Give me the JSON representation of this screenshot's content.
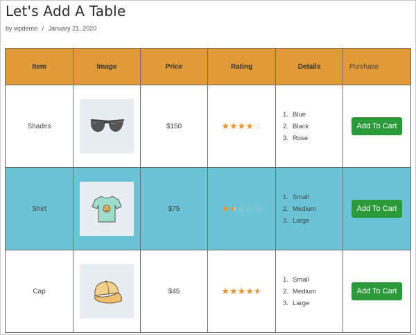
{
  "post": {
    "title": "Let's Add A Table",
    "by_prefix": "by",
    "author": "wpdemo",
    "separator": "/",
    "date": "January 21, 2020"
  },
  "table": {
    "headers": {
      "item": "Item",
      "image": "Image",
      "price": "Price",
      "rating": "Rating",
      "details": "Details",
      "purchase": "Purchase"
    },
    "rows": [
      {
        "item": "Shades",
        "image_icon": "sunglasses-icon",
        "price": "$150",
        "rating": 4,
        "details": [
          "Blue",
          "Black",
          "Rose"
        ],
        "button": "Add To Cart"
      },
      {
        "item": "Shirt",
        "image_icon": "tshirt-icon",
        "price": "$75",
        "rating": 1.5,
        "details": [
          "Small",
          "Medium",
          "Large"
        ],
        "button": "Add To Cart"
      },
      {
        "item": "Cap",
        "image_icon": "cap-icon",
        "price": "$45",
        "rating": 4.5,
        "details": [
          "Small",
          "Medium",
          "Large"
        ],
        "button": "Add To Cart"
      }
    ],
    "list_numbers": [
      "1.",
      "2.",
      "3."
    ]
  },
  "colors": {
    "header_bg": "#e09a38",
    "highlight_row_bg": "#6ac4d6",
    "button_bg": "#2b9a3a",
    "star_color": "#e8922e"
  }
}
